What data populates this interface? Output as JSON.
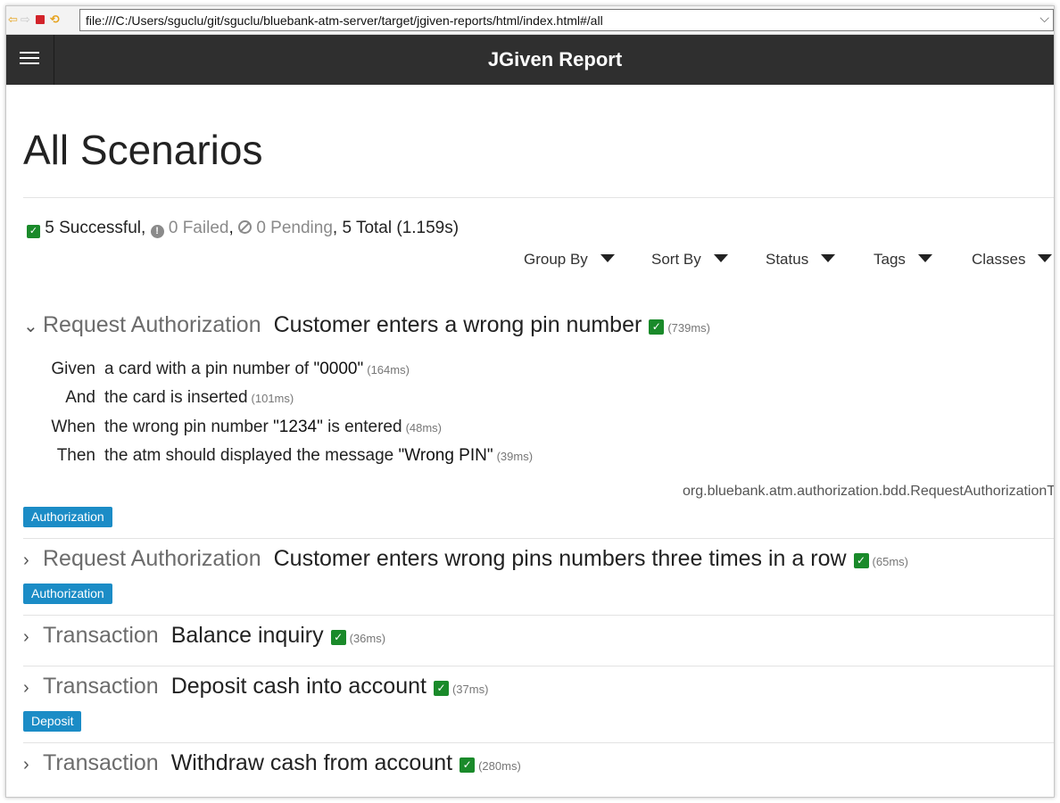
{
  "browser": {
    "url": "file:///C:/Users/sguclu/git/sguclu/bluebank-atm-server/target/jgiven-reports/html/index.html#/all",
    "back_icon": "arrow-left-icon",
    "forward_icon": "arrow-right-icon",
    "stop_icon": "stop-icon",
    "refresh_icon": "refresh-icon"
  },
  "header": {
    "title": "JGiven Report",
    "menu_icon": "hamburger-icon"
  },
  "page": {
    "title": "All Scenarios"
  },
  "summary": {
    "successful": "5 Successful",
    "failed": "0 Failed",
    "pending": "0 Pending",
    "total": "5 Total (1.159s)"
  },
  "filters": [
    "Group By",
    "Sort By",
    "Status",
    "Tags",
    "Classes"
  ],
  "scenarios": [
    {
      "class": "Request Authorization",
      "name": "Customer enters a wrong pin number",
      "duration": "(739ms)",
      "expanded": true,
      "steps": [
        {
          "keyword": "Given",
          "text": "a card with a pin number of ",
          "value": "\"0000\"",
          "duration": "(164ms)"
        },
        {
          "keyword": "And",
          "text": "the card is inserted",
          "value": "",
          "duration": "(101ms)"
        },
        {
          "keyword": "When",
          "text": "the wrong pin number ",
          "value": "\"1234\"",
          "after": " is entered",
          "duration": "(48ms)"
        },
        {
          "keyword": "Then",
          "text": "the atm should displayed the message ",
          "value": "\"Wrong PIN\"",
          "duration": "(39ms)"
        }
      ],
      "class_path": "org.bluebank.atm.authorization.bdd.RequestAuthorizationT",
      "tag": "Authorization"
    },
    {
      "class": "Request Authorization",
      "name": "Customer enters wrong pins numbers three times in a row",
      "duration": "(65ms)",
      "expanded": false,
      "tag": "Authorization"
    },
    {
      "class": "Transaction",
      "name": "Balance inquiry",
      "duration": "(36ms)",
      "expanded": false
    },
    {
      "class": "Transaction",
      "name": "Deposit cash into account",
      "duration": "(37ms)",
      "expanded": false,
      "tag": "Deposit"
    },
    {
      "class": "Transaction",
      "name": "Withdraw cash from account",
      "duration": "(280ms)",
      "expanded": false
    }
  ],
  "colors": {
    "header_bg": "#2f2f2f",
    "success_green": "#1a8a2a",
    "tag_blue": "#1b8cc6",
    "muted_gray": "#8a8a8a"
  }
}
